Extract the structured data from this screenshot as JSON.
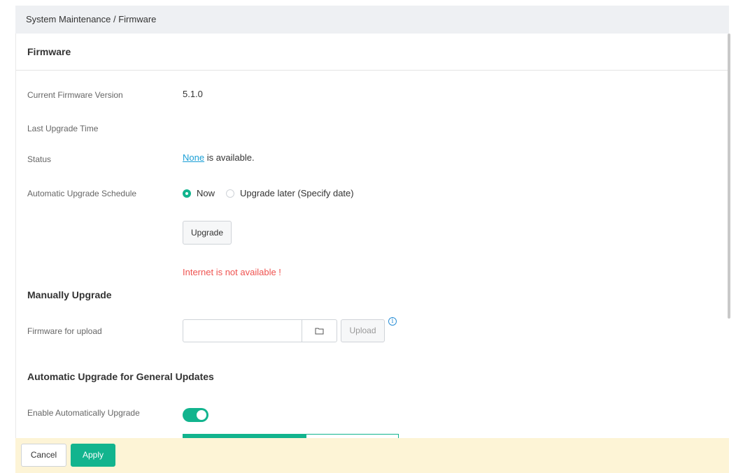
{
  "breadcrumb": "System Maintenance / Firmware",
  "panel_title": "Firmware",
  "fields": {
    "current_version_label": "Current Firmware Version",
    "current_version_value": "5.1.0",
    "last_upgrade_label": "Last Upgrade Time",
    "status_label": "Status",
    "status_link": "None",
    "status_suffix": " is available.",
    "schedule_label": "Automatic Upgrade Schedule",
    "schedule_options": [
      "Now",
      "Upgrade later (Specify date)"
    ],
    "schedule_selected": "Now",
    "upgrade_button": "Upgrade",
    "internet_error": "Internet is not available !"
  },
  "manual": {
    "title": "Manually Upgrade",
    "firmware_label": "Firmware for upload",
    "file_value": "",
    "upload_button": "Upload",
    "info_icon": "info-icon"
  },
  "auto_general": {
    "title": "Automatic Upgrade for General Updates",
    "enable_label": "Enable Automatically Upgrade",
    "enabled": true
  },
  "footer": {
    "cancel": "Cancel",
    "apply": "Apply"
  },
  "colors": {
    "accent": "#12b48e",
    "link": "#1a9fd6",
    "error": "#ef5350",
    "footer_bg": "#fdf4d6"
  }
}
